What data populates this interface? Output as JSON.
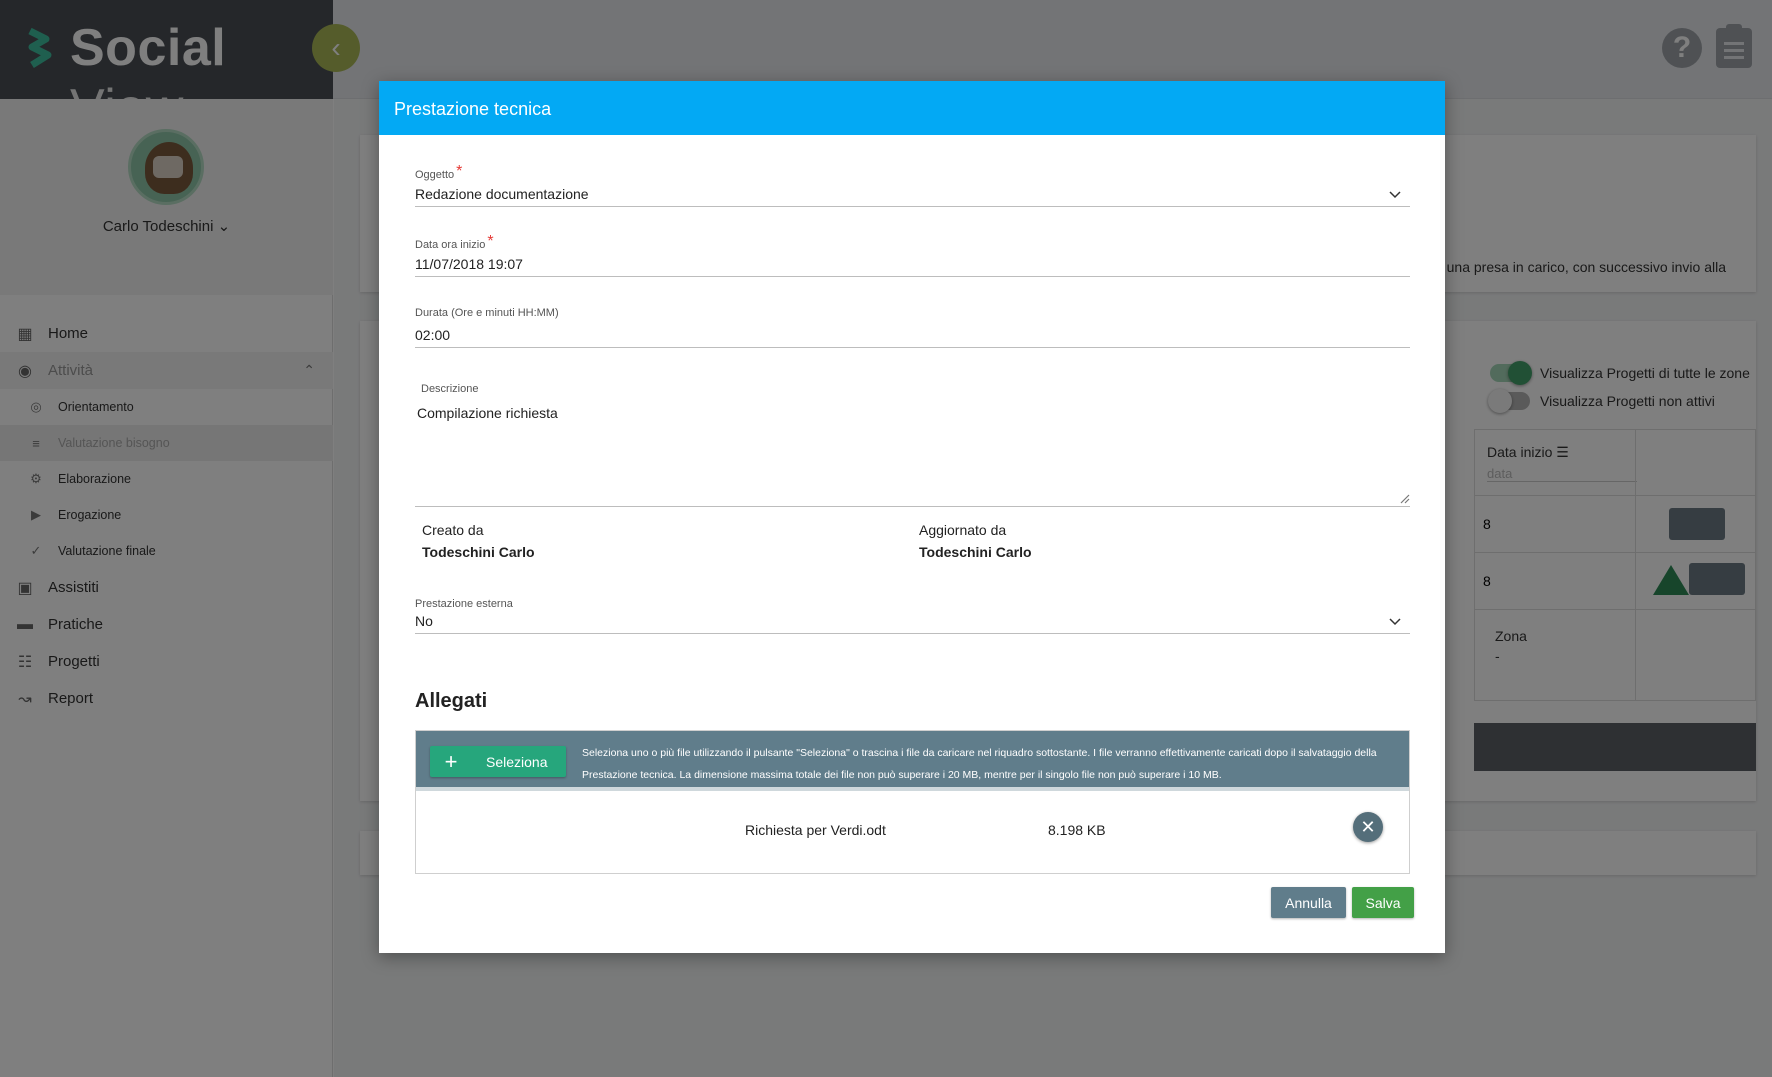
{
  "app": {
    "logo_bold": "Social",
    "logo_light": "View",
    "collapse_icon": "chevron-left-icon"
  },
  "user": {
    "name": "Carlo Todeschini"
  },
  "sidebar": {
    "items": [
      {
        "label": "Home",
        "icon": "dashboard-icon"
      },
      {
        "label": "Attività",
        "icon": "palette-icon"
      },
      {
        "label": "Assistiti",
        "icon": "person-icon"
      },
      {
        "label": "Pratiche",
        "icon": "folder-icon"
      },
      {
        "label": "Progetti",
        "icon": "list-icon"
      },
      {
        "label": "Report",
        "icon": "trend-icon"
      }
    ],
    "subitems": [
      {
        "label": "Orientamento",
        "icon": "compass-icon"
      },
      {
        "label": "Valutazione bisogno",
        "icon": "checklist-icon"
      },
      {
        "label": "Elaborazione",
        "icon": "gear-icon"
      },
      {
        "label": "Erogazione",
        "icon": "play-icon"
      },
      {
        "label": "Valutazione finale",
        "icon": "check-icon"
      }
    ]
  },
  "background": {
    "card_text": "a una presa in carico, con successivo invio alla",
    "toggle_all_zones": "Visualizza Progetti di tutte le zone",
    "toggle_inactive": "Visualizza Progetti non attivi",
    "col_data_inizio": "Data inizio",
    "col_data_placeholder": "data",
    "row1_val": "8",
    "row2_val": "8",
    "zona_label": "Zona",
    "zona_value": "-"
  },
  "modal": {
    "title": "Prestazione tecnica",
    "oggetto": {
      "label": "Oggetto",
      "value": "Redazione documentazione"
    },
    "data_inizio": {
      "label": "Data ora inizio",
      "value": "11/07/2018 19:07"
    },
    "durata": {
      "label": "Durata (Ore e minuti HH:MM)",
      "value": "02:00"
    },
    "descrizione": {
      "label": "Descrizione",
      "value": "Compilazione richiesta"
    },
    "creato": {
      "label": "Creato da",
      "value": "Todeschini Carlo"
    },
    "aggiornato": {
      "label": "Aggiornato da",
      "value": "Todeschini Carlo"
    },
    "esterna": {
      "label": "Prestazione esterna",
      "value": "No"
    },
    "allegati_title": "Allegati",
    "select_label": "Seleziona",
    "upload_info": "Seleziona uno o più file utilizzando il pulsante \"Seleziona\" o trascina i file da caricare nel riquadro sottostante. I file verranno effettivamente caricati dopo il salvataggio della Prestazione tecnica. La dimensione massima totale dei file non può superare i 20 MB, mentre per il singolo file non può superare i 10 MB.",
    "files": [
      {
        "name": "Richiesta per Verdi.odt",
        "size": "8.198 KB"
      }
    ],
    "cancel_label": "Annulla",
    "save_label": "Salva"
  },
  "colors": {
    "header_blue": "#03a9f4",
    "select_green": "#26a67c",
    "save_green": "#43a047",
    "cancel_grey": "#607d8b",
    "required_red": "#e53935"
  }
}
